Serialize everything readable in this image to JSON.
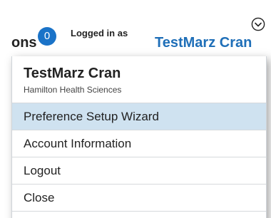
{
  "header": {
    "nav_label_partial": "ons",
    "notification_count": "0",
    "logged_in_label": "Logged in as",
    "user_name_partial": "TestMarz Cran",
    "menu_toggle_icon": "chevron-down-circle-icon"
  },
  "profile": {
    "name": "TestMarz Cran",
    "organization": "Hamilton Health Sciences"
  },
  "menu": {
    "items": [
      {
        "label": "Preference Setup Wizard",
        "highlighted": true
      },
      {
        "label": "Account Information",
        "highlighted": false
      },
      {
        "label": "Logout",
        "highlighted": false
      },
      {
        "label": "Close",
        "highlighted": false
      }
    ]
  },
  "colors": {
    "accent_blue": "#1f6fb8",
    "badge_blue": "#1a73c8",
    "highlight_row": "#cfe2f0"
  }
}
